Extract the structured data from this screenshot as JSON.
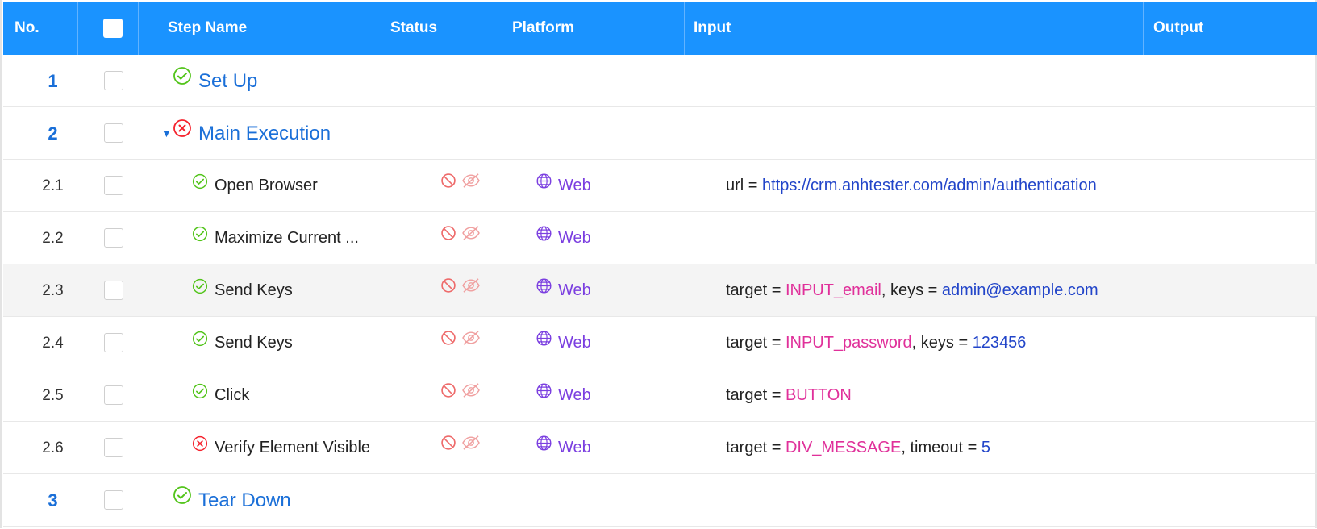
{
  "header": {
    "no": "No.",
    "step_name": "Step Name",
    "status": "Status",
    "platform": "Platform",
    "input": "Input",
    "output": "Output"
  },
  "rows": [
    {
      "no": "1",
      "name": "Set Up",
      "result": "pass",
      "top": true
    },
    {
      "no": "2",
      "name": "Main Execution",
      "result": "fail",
      "top": true,
      "expanded": true
    },
    {
      "no": "2.1",
      "name": "Open Browser",
      "result": "pass",
      "platform": "Web",
      "input": [
        {
          "k": "url = ",
          "v": "https://crm.anhtester.com/admin/authentication",
          "t": "val"
        }
      ]
    },
    {
      "no": "2.2",
      "name": "Maximize Current ...",
      "result": "pass",
      "platform": "Web",
      "input": []
    },
    {
      "no": "2.3",
      "name": "Send Keys",
      "result": "pass",
      "platform": "Web",
      "highlight": true,
      "input": [
        {
          "k": "target = ",
          "v": "INPUT_email",
          "t": "tgt"
        },
        {
          "k": ", keys = ",
          "v": "admin@example.com",
          "t": "val"
        }
      ]
    },
    {
      "no": "2.4",
      "name": "Send Keys",
      "result": "pass",
      "platform": "Web",
      "input": [
        {
          "k": "target = ",
          "v": "INPUT_password",
          "t": "tgt"
        },
        {
          "k": ", keys = ",
          "v": "123456",
          "t": "val"
        }
      ]
    },
    {
      "no": "2.5",
      "name": "Click",
      "result": "pass",
      "platform": "Web",
      "input": [
        {
          "k": "target = ",
          "v": "BUTTON",
          "t": "tgt"
        }
      ]
    },
    {
      "no": "2.6",
      "name": "Verify Element Visible",
      "result": "fail",
      "platform": "Web",
      "input": [
        {
          "k": "target = ",
          "v": "DIV_MESSAGE",
          "t": "tgt"
        },
        {
          "k": ", timeout = ",
          "v": "5",
          "t": "val"
        }
      ]
    },
    {
      "no": "3",
      "name": "Tear Down",
      "result": "pass",
      "top": true
    }
  ],
  "icons": {
    "pass": "check-circle-icon",
    "fail": "x-circle-icon",
    "status_1": "ban-icon",
    "status_2": "eye-off-icon",
    "platform": "globe-icon"
  },
  "colors": {
    "header_bg": "#1a93ff",
    "pass": "#52c41a",
    "fail": "#f5222d",
    "link": "#1a6fd8",
    "platform": "#7b3fe0",
    "target": "#e0309a",
    "value": "#2245c9"
  }
}
